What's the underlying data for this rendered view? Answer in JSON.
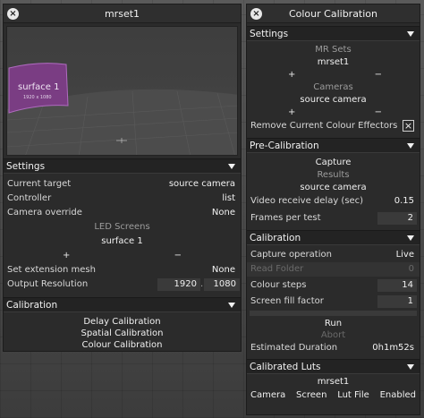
{
  "left_panel": {
    "title": "mrset1",
    "viewport": {
      "surface_label": "surface 1",
      "surface_sublabel": "1920 x 1080"
    },
    "settings": {
      "header": "Settings",
      "current_target_label": "Current target",
      "current_target_value": "source camera",
      "controller_label": "Controller",
      "controller_value": "list",
      "camera_override_label": "Camera override",
      "camera_override_value": "None",
      "led_screens_label": "LED Screens",
      "led_screen_item": "surface 1",
      "plus": "+",
      "minus": "−",
      "set_extension_mesh_label": "Set extension mesh",
      "set_extension_mesh_value": "None",
      "output_resolution_label": "Output Resolution",
      "output_resolution_w": "1920",
      "output_resolution_h": "1080",
      "resolution_sep": "."
    },
    "calibration": {
      "header": "Calibration",
      "items": [
        "Delay Calibration",
        "Spatial Calibration",
        "Colour Calibration"
      ]
    }
  },
  "right_panel": {
    "title": "Colour Calibration",
    "settings": {
      "header": "Settings",
      "mr_sets_label": "MR Sets",
      "mr_set_item": "mrset1",
      "cameras_label": "Cameras",
      "camera_item": "source camera",
      "plus": "+",
      "minus": "−",
      "remove_effectors_label": "Remove Current Colour Effectors",
      "remove_effectors_checked": true
    },
    "pre_calibration": {
      "header": "Pre-Calibration",
      "capture": "Capture",
      "results_label": "Results",
      "results_value": "source camera",
      "video_delay_label": "Video receive delay (sec)",
      "video_delay_value": "0.15",
      "frames_per_test_label": "Frames per test",
      "frames_per_test_value": "2"
    },
    "calibration": {
      "header": "Calibration",
      "capture_operation_label": "Capture operation",
      "capture_operation_value": "Live",
      "read_folder_label": "Read Folder",
      "read_folder_value": "0",
      "colour_steps_label": "Colour steps",
      "colour_steps_value": "14",
      "screen_fill_label": "Screen fill factor",
      "screen_fill_value": "1",
      "run": "Run",
      "abort": "Abort",
      "est_duration_label": "Estimated Duration",
      "est_duration_value": "0h1m52s"
    },
    "luts": {
      "header": "Calibrated Luts",
      "set_name": "mrset1",
      "columns": [
        "Camera",
        "Screen",
        "Lut File",
        "Enabled"
      ]
    }
  }
}
